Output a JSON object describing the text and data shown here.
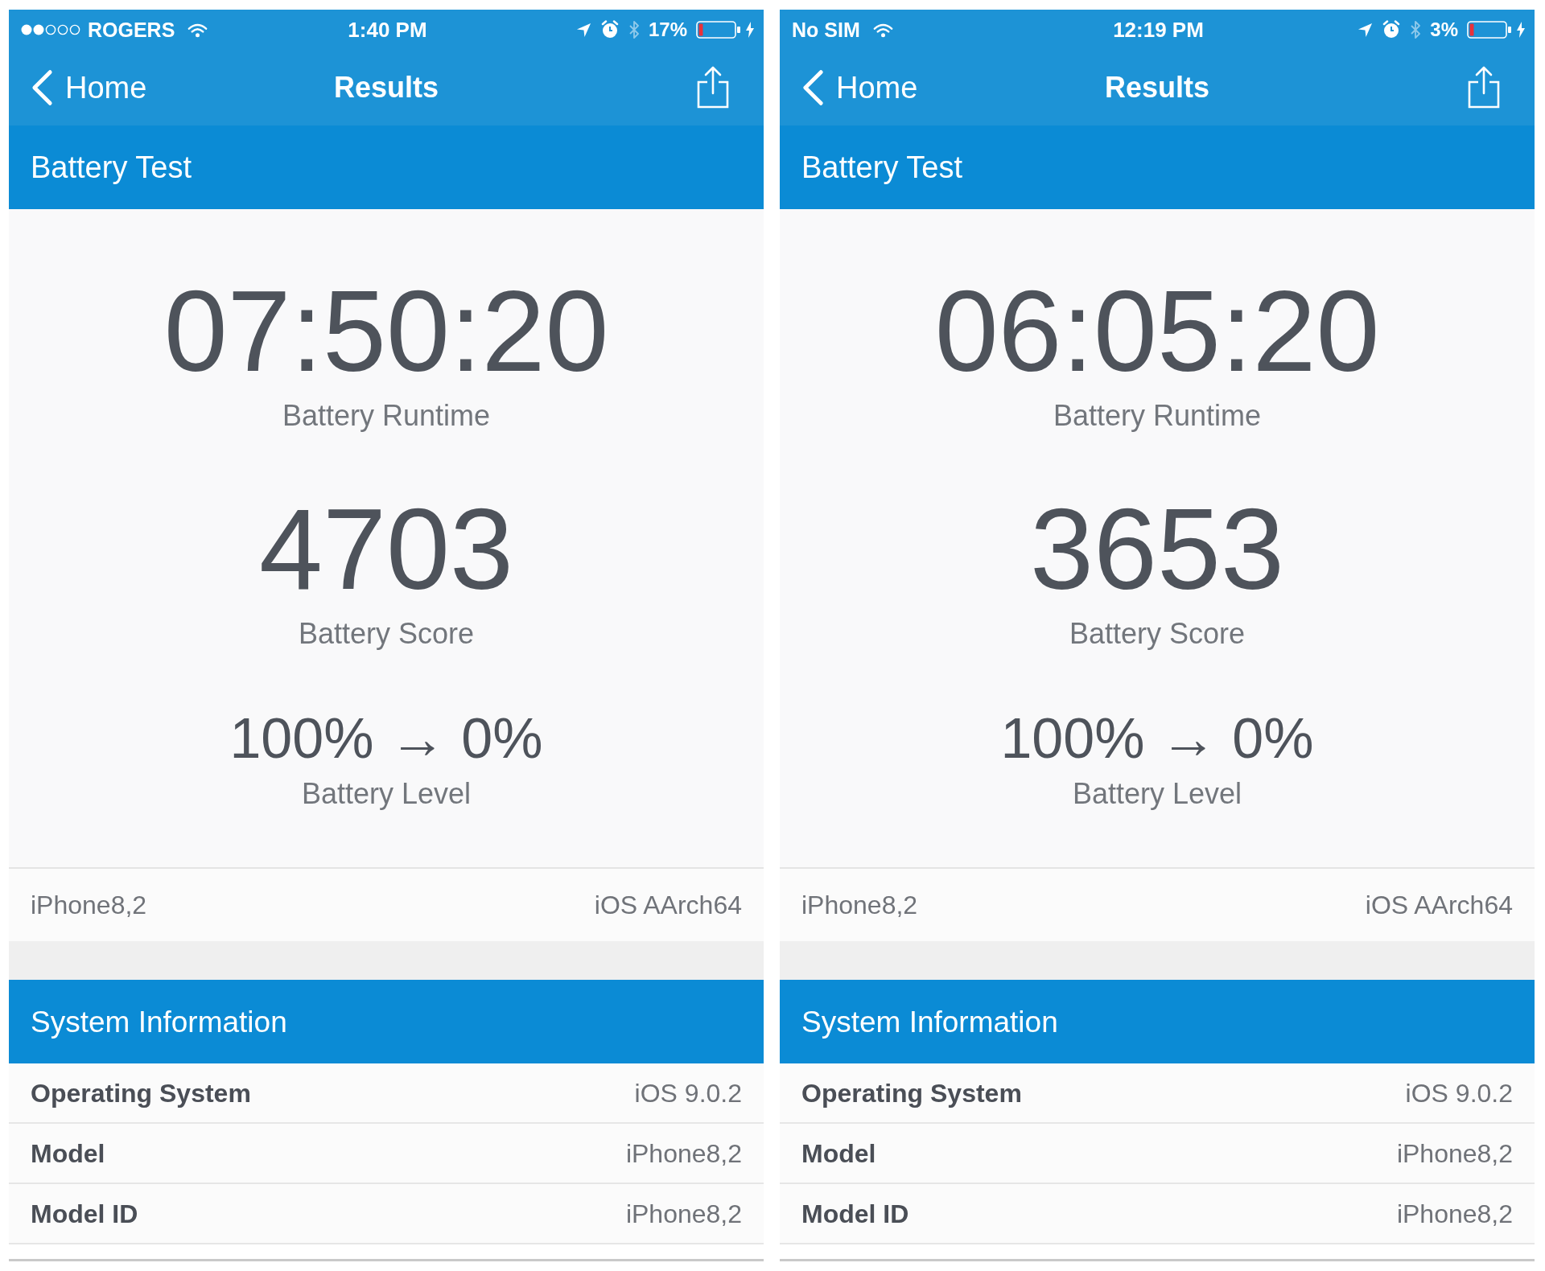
{
  "screens": [
    {
      "status_bar": {
        "signal": true,
        "carrier": "ROGERS",
        "time": "1:40 PM",
        "battery_percent": "17%"
      },
      "nav_bar": {
        "back": "Home",
        "title": "Results"
      },
      "section_title": "Battery Test",
      "metrics": [
        {
          "kind": "large",
          "value": "07:50:20",
          "label": "Battery Runtime"
        },
        {
          "kind": "large",
          "value": "4703",
          "label": "Battery Score"
        },
        {
          "kind": "medium",
          "value": "100% → 0%",
          "label": "Battery Level"
        }
      ],
      "summary": {
        "device": "iPhone8,2",
        "platform": "iOS AArch64"
      },
      "system_information": {
        "title": "System Information",
        "rows": [
          {
            "label": "Operating System",
            "value": "iOS 9.0.2"
          },
          {
            "label": "Model",
            "value": "iPhone8,2"
          },
          {
            "label": "Model ID",
            "value": "iPhone8,2"
          }
        ]
      }
    },
    {
      "status_bar": {
        "signal": false,
        "carrier": "No SIM",
        "time": "12:19 PM",
        "battery_percent": "3%"
      },
      "nav_bar": {
        "back": "Home",
        "title": "Results"
      },
      "section_title": "Battery Test",
      "metrics": [
        {
          "kind": "large",
          "value": "06:05:20",
          "label": "Battery Runtime"
        },
        {
          "kind": "large",
          "value": "3653",
          "label": "Battery Score"
        },
        {
          "kind": "medium",
          "value": "100% → 0%",
          "label": "Battery Level"
        }
      ],
      "summary": {
        "device": "iPhone8,2",
        "platform": "iOS AArch64"
      },
      "system_information": {
        "title": "System Information",
        "rows": [
          {
            "label": "Operating System",
            "value": "iOS 9.0.2"
          },
          {
            "label": "Model",
            "value": "iPhone8,2"
          },
          {
            "label": "Model ID",
            "value": "iPhone8,2"
          }
        ]
      }
    }
  ]
}
